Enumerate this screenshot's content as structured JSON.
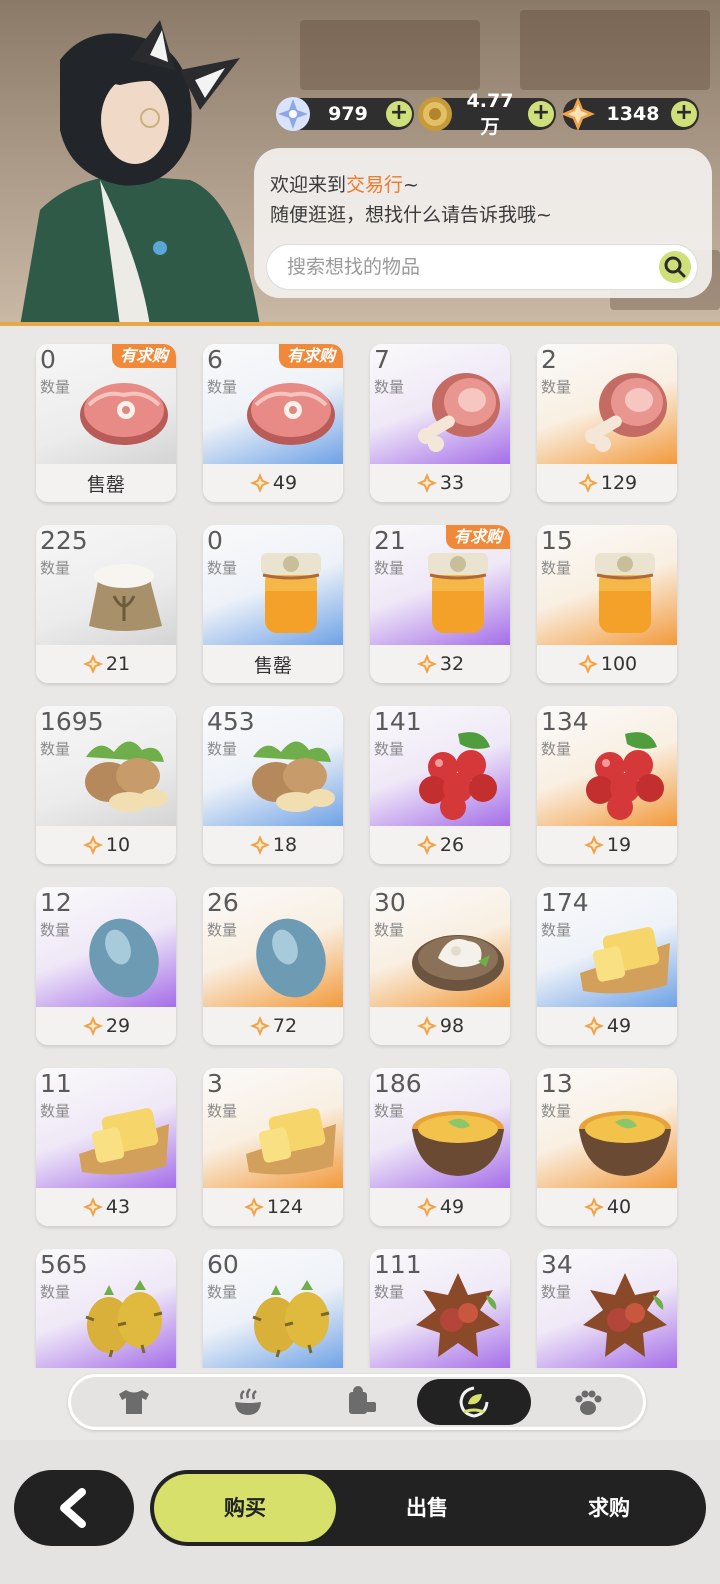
{
  "currencies": [
    {
      "name": "star-crystal",
      "value": "979",
      "color": "#b9c8f0"
    },
    {
      "name": "gold-coin",
      "value": "4.77万",
      "color": "#c59a3a"
    },
    {
      "name": "orange-gem",
      "value": "1348",
      "color": "#f0a24a"
    }
  ],
  "greeting": {
    "line1_prefix": "欢迎来到",
    "line1_accent": "交易行",
    "line1_suffix": "~",
    "line2": "随便逛逛，想找什么请告诉我哦~"
  },
  "search": {
    "placeholder": "搜索想找的物品"
  },
  "labels": {
    "quantity": "数量",
    "wanted_badge": "有求购",
    "sold_out": "售罄"
  },
  "items": [
    {
      "count": "0",
      "price": "售罄",
      "badge": true,
      "tint": "gray",
      "icon": "steak"
    },
    {
      "count": "6",
      "price": "49",
      "badge": true,
      "tint": "blue",
      "icon": "steak"
    },
    {
      "count": "7",
      "price": "33",
      "badge": false,
      "tint": "purple",
      "icon": "ham"
    },
    {
      "count": "2",
      "price": "129",
      "badge": false,
      "tint": "orange",
      "icon": "ham"
    },
    {
      "count": "225",
      "price": "21",
      "badge": false,
      "tint": "gray",
      "icon": "flour-sack"
    },
    {
      "count": "0",
      "price": "售罄",
      "badge": false,
      "tint": "blue",
      "icon": "honey-jar"
    },
    {
      "count": "21",
      "price": "32",
      "badge": true,
      "tint": "purple",
      "icon": "honey-jar"
    },
    {
      "count": "15",
      "price": "100",
      "badge": false,
      "tint": "orange",
      "icon": "honey-jar"
    },
    {
      "count": "1695",
      "price": "10",
      "badge": false,
      "tint": "gray",
      "icon": "potatoes"
    },
    {
      "count": "453",
      "price": "18",
      "badge": false,
      "tint": "blue",
      "icon": "potatoes"
    },
    {
      "count": "141",
      "price": "26",
      "badge": false,
      "tint": "purple",
      "icon": "red-berries"
    },
    {
      "count": "134",
      "price": "19",
      "badge": false,
      "tint": "orange",
      "icon": "red-berries"
    },
    {
      "count": "12",
      "price": "29",
      "badge": false,
      "tint": "purple",
      "icon": "blue-egg"
    },
    {
      "count": "26",
      "price": "72",
      "badge": false,
      "tint": "orange",
      "icon": "blue-egg"
    },
    {
      "count": "30",
      "price": "98",
      "badge": false,
      "tint": "orange",
      "icon": "cheese-bowl"
    },
    {
      "count": "174",
      "price": "49",
      "badge": false,
      "tint": "blue",
      "icon": "butter"
    },
    {
      "count": "11",
      "price": "43",
      "badge": false,
      "tint": "purple",
      "icon": "butter"
    },
    {
      "count": "3",
      "price": "124",
      "badge": false,
      "tint": "orange",
      "icon": "butter"
    },
    {
      "count": "186",
      "price": "49",
      "badge": false,
      "tint": "purple",
      "icon": "soup-bowl"
    },
    {
      "count": "13",
      "price": "40",
      "badge": false,
      "tint": "orange",
      "icon": "soup-bowl"
    },
    {
      "count": "565",
      "price": "",
      "badge": false,
      "tint": "purple",
      "icon": "spiky-fruit"
    },
    {
      "count": "60",
      "price": "",
      "badge": false,
      "tint": "blue",
      "icon": "spiky-fruit"
    },
    {
      "count": "111",
      "price": "",
      "badge": false,
      "tint": "purple",
      "icon": "chestnut"
    },
    {
      "count": "34",
      "price": "",
      "badge": false,
      "tint": "purple",
      "icon": "chestnut"
    }
  ],
  "category_tabs": [
    {
      "name": "clothing",
      "icon": "shirt-icon",
      "active": false
    },
    {
      "name": "food",
      "icon": "bowl-icon",
      "active": false
    },
    {
      "name": "furniture",
      "icon": "furniture-icon",
      "active": false
    },
    {
      "name": "ingredients",
      "icon": "leaf-swirl-icon",
      "active": true
    },
    {
      "name": "pets",
      "icon": "paw-icon",
      "active": false
    }
  ],
  "actions": {
    "buy": "购买",
    "sell": "出售",
    "request": "求购"
  }
}
